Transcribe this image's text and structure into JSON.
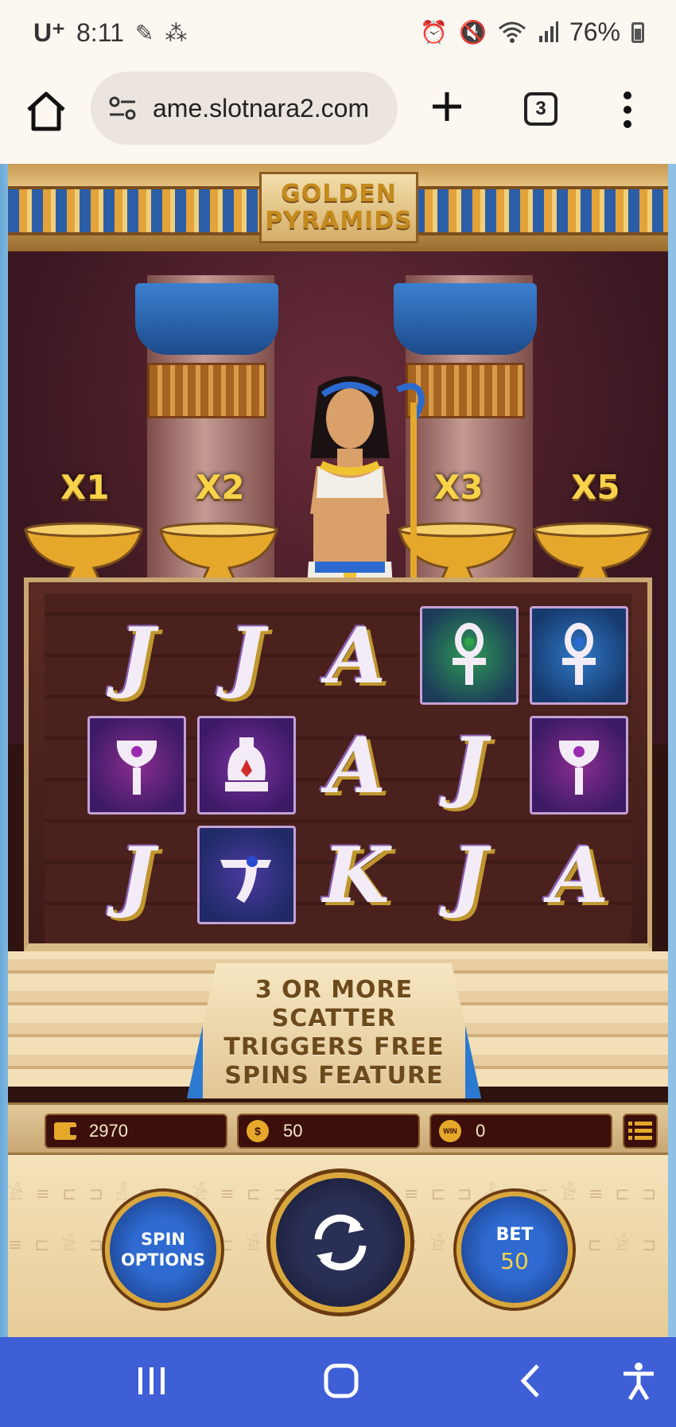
{
  "status_bar": {
    "carrier": "U⁺",
    "time": "8:11",
    "battery": "76%",
    "icons": [
      "notification-icon",
      "app-icon",
      "alarm-icon",
      "mute-icon",
      "wifi-icon",
      "signal-icon",
      "battery-icon"
    ]
  },
  "browser": {
    "url": "ame.slotnara2.com",
    "tab_count": "3"
  },
  "game": {
    "logo_line1": "GOLDEN",
    "logo_line2": "PYRAMIDS",
    "multipliers": [
      "X1",
      "X2",
      "X3",
      "X5"
    ],
    "reels": [
      [
        "J",
        "J",
        "A",
        "ankh-green",
        "ankh-blue"
      ],
      [
        "scepter-purple",
        "vase-red",
        "A",
        "J",
        "scepter-purple"
      ],
      [
        "J",
        "eye-blue",
        "K",
        "J",
        "A"
      ]
    ],
    "scatter_text": [
      "3 OR MORE",
      "SCATTER",
      "TRIGGERS FREE",
      "SPINS FEATURE"
    ],
    "balance": "2970",
    "bet_amount": "50",
    "coin_icon_label": "$",
    "win_icon_label": "WIN",
    "win": "0",
    "spin_options_label_1": "SPIN",
    "spin_options_label_2": "OPTIONS",
    "bet_label": "BET",
    "bet_value": "50"
  },
  "colors": {
    "gold": "#d9a73c",
    "button_blue": "#2e6ad0",
    "nav_bar": "#3f5fd6",
    "info_box": "#3c0f0c"
  }
}
